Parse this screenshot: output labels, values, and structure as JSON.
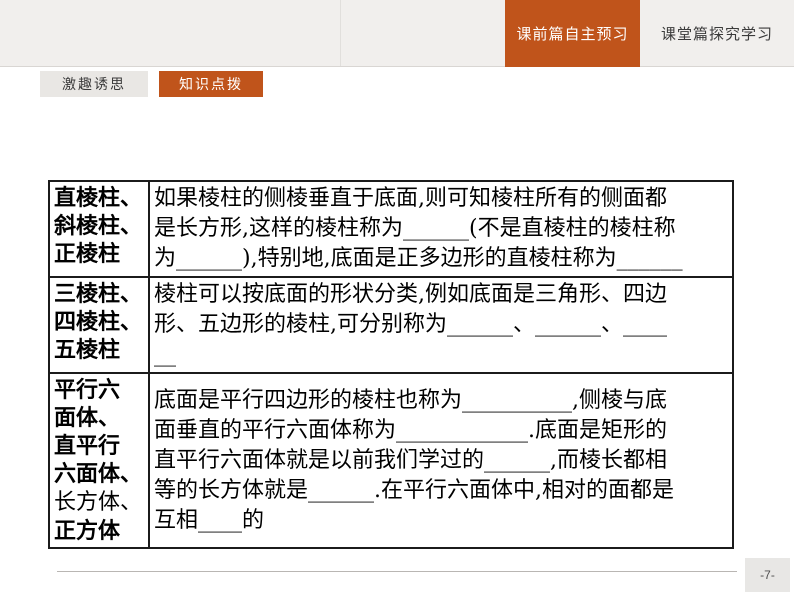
{
  "colors": {
    "accent_orange": "#c0541b",
    "topbar_bg": "#f1efed",
    "plain_button_bg": "#e9e7e4",
    "page_box_bg": "#e8e7e5",
    "table_border": "#1b1b1b"
  },
  "topbar": {
    "tabs": [
      {
        "label": "课前篇自主预习",
        "active": true
      },
      {
        "label": "课堂篇探究学习",
        "active": false
      }
    ]
  },
  "subnav": {
    "buttons": [
      {
        "label": "激趣诱思",
        "active": false
      },
      {
        "label": "知识点拨",
        "active": true
      }
    ]
  },
  "table": {
    "rows": [
      {
        "term": "直棱柱、\n斜棱柱、\n正棱柱",
        "definition": "如果棱柱的侧棱垂直于底面,则可知棱柱所有的侧面都\n是长方形,这样的棱柱称为______(不是直棱柱的棱柱称\n为______),特别地,底面是正多边形的直棱柱称为______"
      },
      {
        "term": "三棱柱、\n四棱柱、\n五棱柱",
        "definition": "棱柱可以按底面的形状分类,例如底面是三角形、四边\n形、五边形的棱柱,可分别称为______、______、____\n__"
      },
      {
        "term_parts": {
          "bold_top": "平行六\n面体、\n直平行\n六面体、\n",
          "regular": "长方体、\n",
          "bold_bottom": "正方体"
        },
        "definition": "底面是平行四边形的棱柱也称为__________,侧棱与底\n面垂直的平行六面体称为____________.底面是矩形的\n直平行六面体就是以前我们学过的______,而棱长都相\n等的长方体就是______.在平行六面体中,相对的面都是\n互相____的"
      }
    ]
  },
  "footer": {
    "page_number": "-7-"
  }
}
